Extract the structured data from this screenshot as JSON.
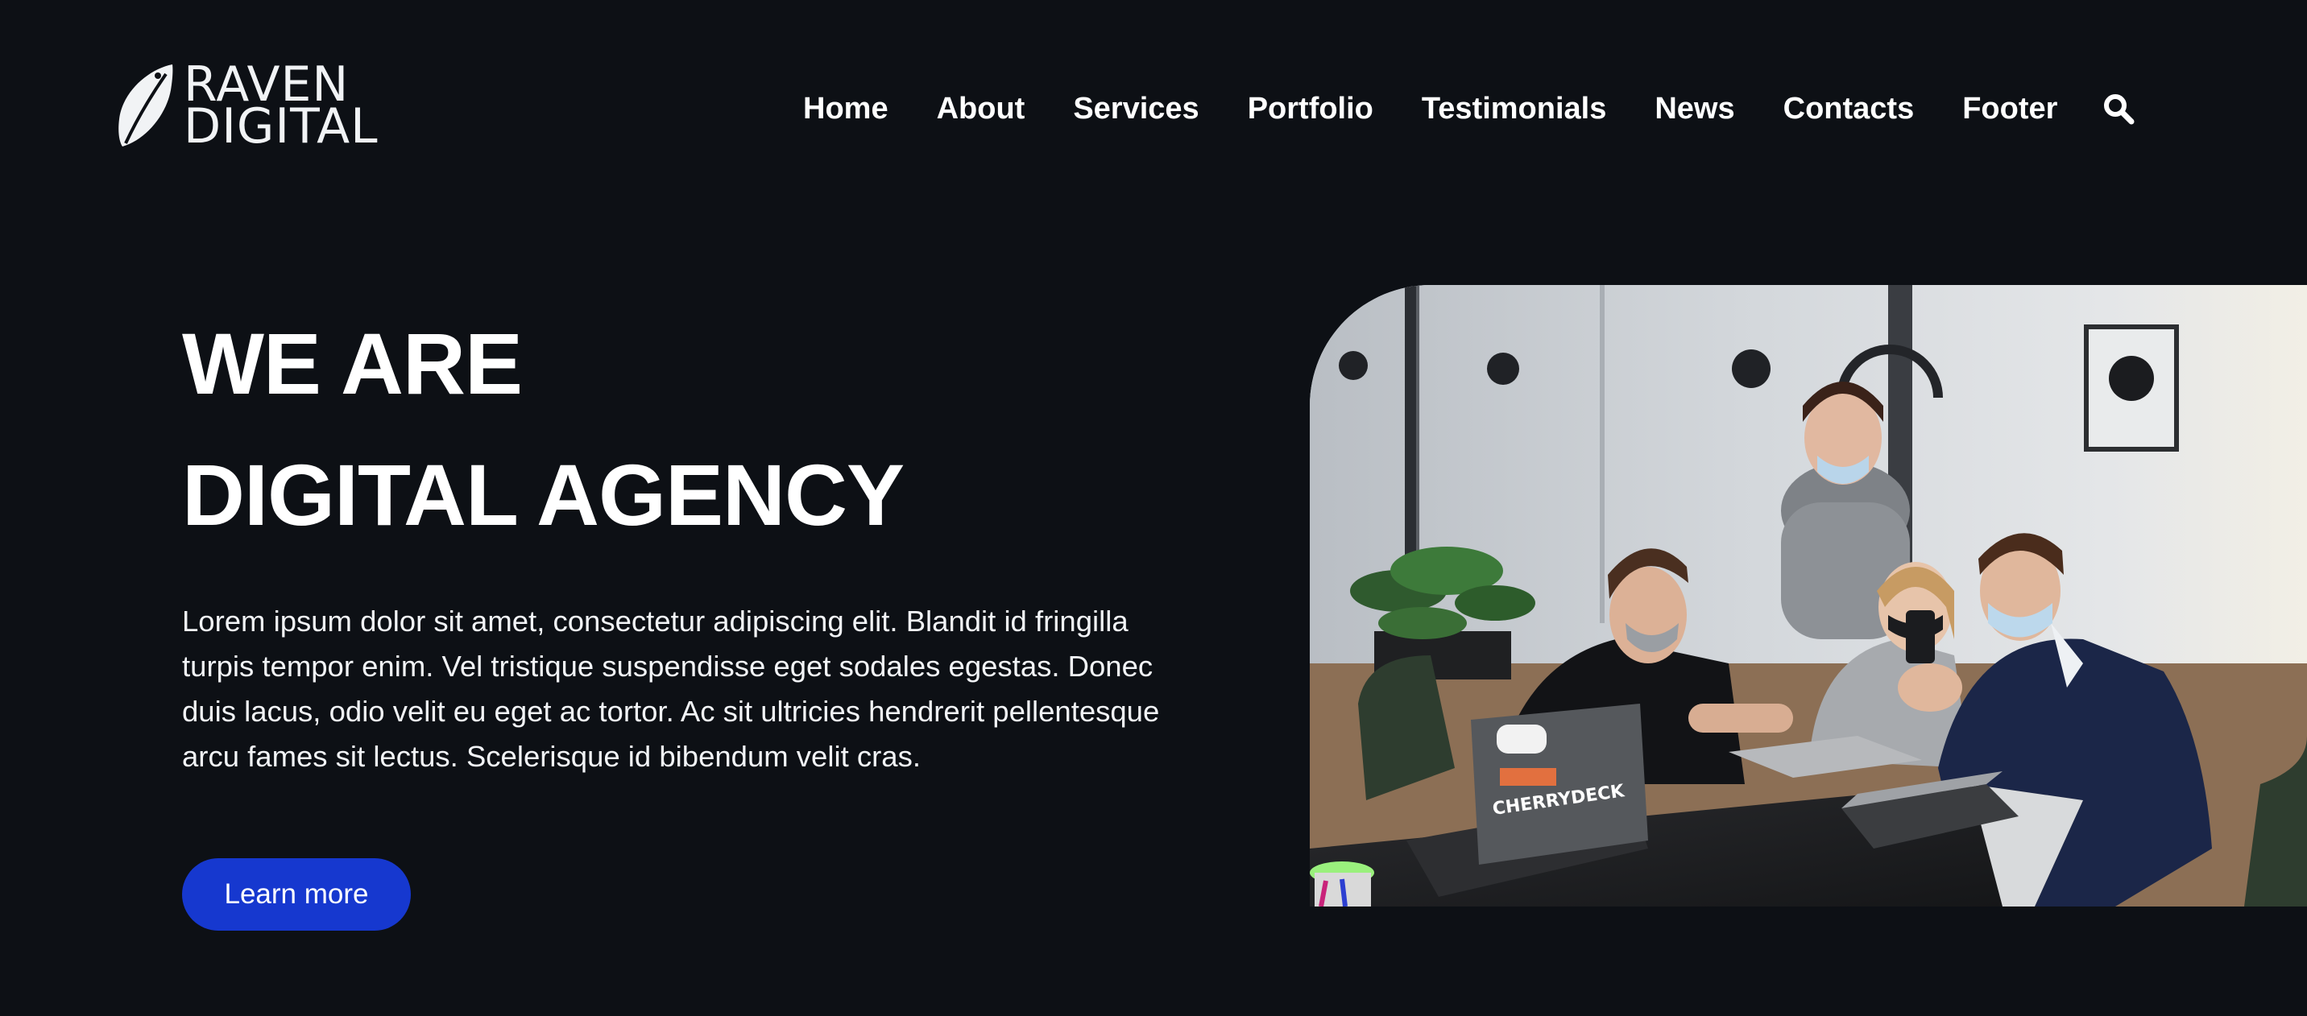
{
  "brand": {
    "line1": "RAVEN",
    "line2": "DIGITAL"
  },
  "nav": {
    "items": [
      "Home",
      "About",
      "Services",
      "Portfolio",
      "Testimonials",
      "News",
      "Contacts",
      "Footer"
    ],
    "search_icon": "search-icon"
  },
  "hero": {
    "title_line1": "WE ARE",
    "title_line2": "DIGITAL AGENCY",
    "body": "Lorem ipsum dolor sit amet, consectetur adipiscing elit. Blandit id fringilla turpis tempor enim. Vel tristique suspendisse eget sodales egestas. Donec duis lacus, odio velit eu eget ac tortor. Ac sit ultricies hendrerit pellentesque arcu fames sit lectus. Scelerisque id bibendum velit cras.",
    "cta_label": "Learn more",
    "laptop_sticker": "CHERRYDECK"
  },
  "colors": {
    "background": "#0d1015",
    "accent": "#1638cf",
    "text": "#ffffff"
  }
}
